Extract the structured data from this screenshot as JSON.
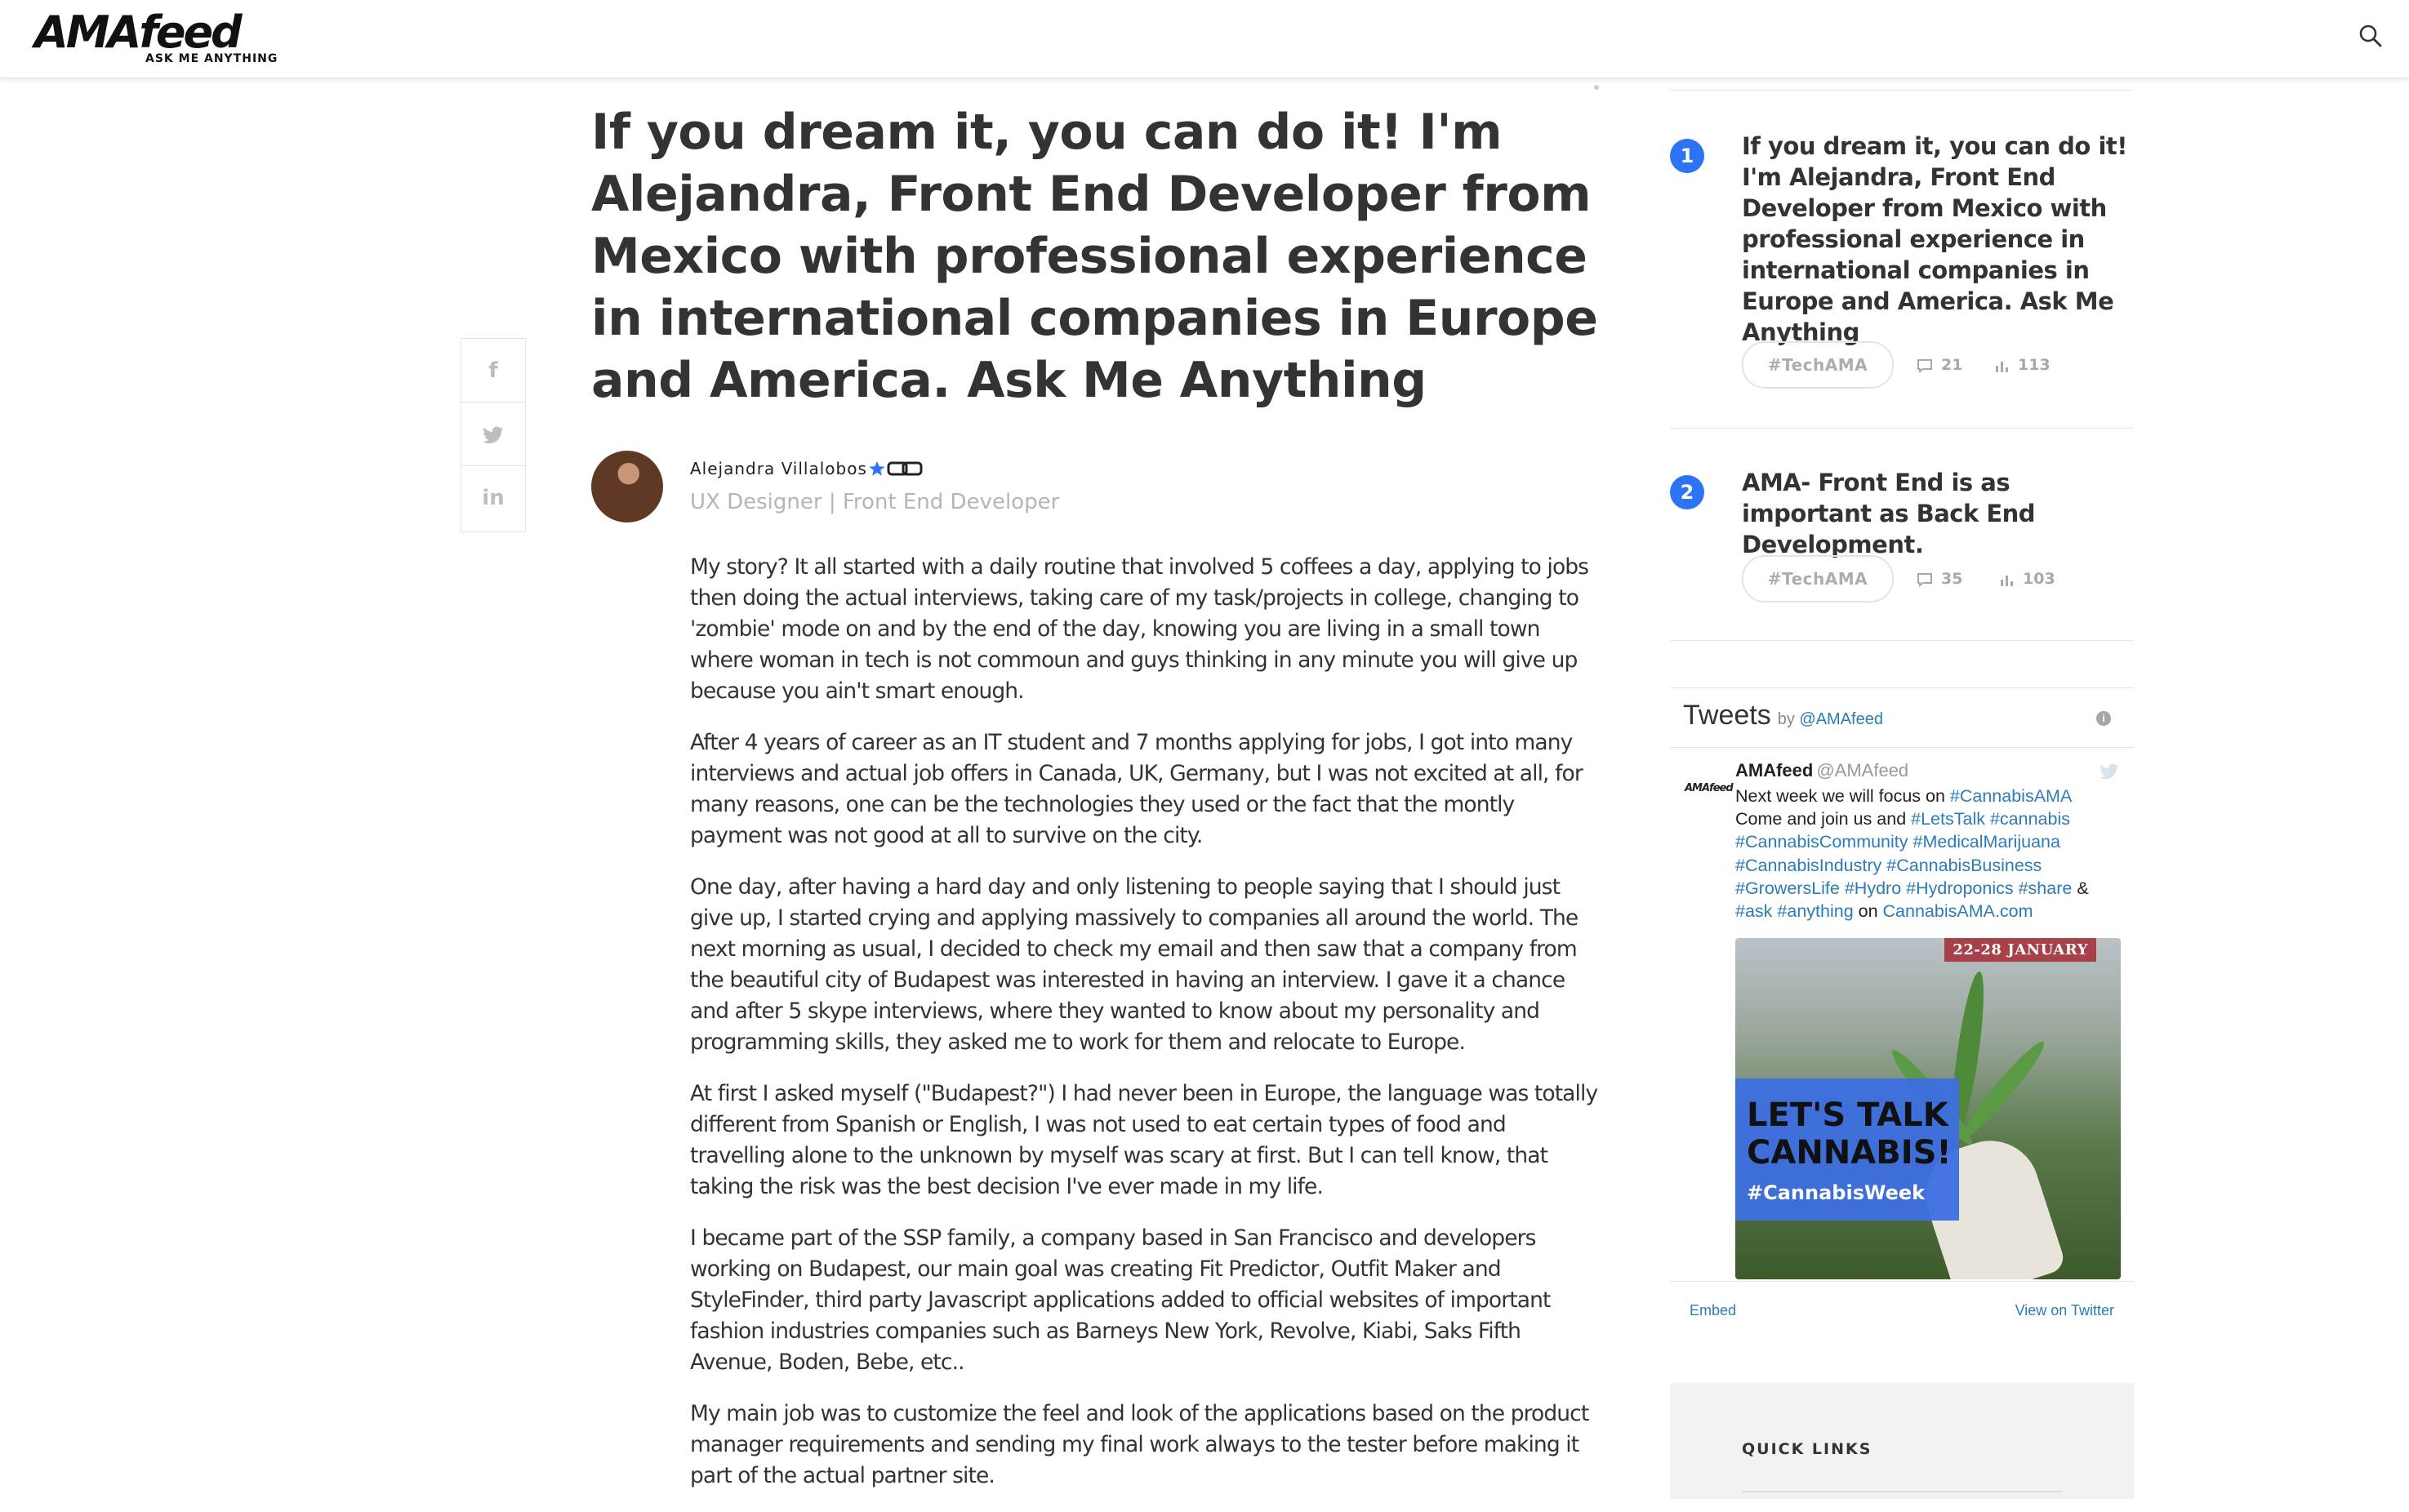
{
  "header": {
    "logo_main": "AMAfeed",
    "logo_sub": "ASK ME ANYTHING"
  },
  "share": {
    "facebook": "f",
    "twitter_icon": "twitter-bird",
    "linkedin": "in"
  },
  "article": {
    "title": "If you dream it, you can do it! I'm Alejandra, Front End Developer from Mexico with professional experience in international companies in Europe and America. Ask Me Anything",
    "author_name": "Alejandra Villalobos",
    "author_role": "UX Designer | Front End Developer",
    "paragraphs": [
      "My story? It all started with a daily routine that involved 5 coffees a day, applying to jobs then doing the actual interviews, taking care of my task/projects in college, changing to 'zombie' mode on and by the end of the day, knowing you are living in a small town where woman in tech is not commoun and guys thinking in any minute you will give up because you ain't smart enough.",
      "After 4 years of career as an IT student and 7 months applying for jobs, I got into many interviews and actual job offers in Canada, UK, Germany, but I was not excited at all, for many reasons, one can be the technologies they used or the fact that the montly payment was not good at all to survive on the city.",
      "One day, after having a hard day and only listening to people saying that I should just give up, I started crying and applying massively to companies all around the world. The next morning as usual, I decided to check my email and then saw that a company from the beautiful city of Budapest was interested in having an interview. I gave it a chance and after 5 skype interviews, where they wanted to know about my personality and programming skills, they asked me to work for them and relocate to Europe.",
      "At first I asked myself (\"Budapest?\") I had never been in Europe, the language was totally different from Spanish or English, I was not used to eat certain types of food and travelling alone to the unknown by myself was scary at first. But I can tell know, that taking the risk was the best decision I've ever made in my life.",
      "I became part of the SSP family, a company based in San Francisco and developers working on Budapest, our main goal was creating Fit Predictor, Outfit Maker and StyleFinder, third party Javascript applications added to official websites of important fashion industries companies such as Barneys New York, Revolve, Kiabi, Saks Fifth Avenue, Boden, Bebe, etc..",
      "My main job was to customize the feel and look of the applications based on the product manager requirements and sending my final work always to the tester before making it part of the actual partner site."
    ]
  },
  "sidebar": {
    "ranked": [
      {
        "rank": "1",
        "title": "If you dream it, you can do it! I'm Alejandra, Front End Developer from Mexico with professional experience in international companies in Europe and America. Ask Me Anything",
        "tag": "#TechAMA",
        "comments": "21",
        "views": "113"
      },
      {
        "rank": "2",
        "title": "AMA- Front End is as important as Back End Development.",
        "tag": "#TechAMA",
        "comments": "35",
        "views": "103"
      }
    ],
    "tweets": {
      "title": "Tweets",
      "by": "by",
      "handle": "@AMAfeed",
      "info": "i",
      "tweet": {
        "avatar_text": "AMAfeed",
        "name": "AMAfeed",
        "handle": "@AMAfeed",
        "text_parts": [
          {
            "t": "Next week we will focus on ",
            "link": false
          },
          {
            "t": "#CannabisAMA",
            "link": true
          },
          {
            "t": " Come and join us and ",
            "link": false
          },
          {
            "t": "#LetsTalk",
            "link": true
          },
          {
            "t": " ",
            "link": false
          },
          {
            "t": "#cannabis",
            "link": true
          },
          {
            "t": " ",
            "link": false
          },
          {
            "t": "#CannabisCommunity",
            "link": true
          },
          {
            "t": " ",
            "link": false
          },
          {
            "t": "#MedicalMarijuana",
            "link": true
          },
          {
            "t": " ",
            "link": false
          },
          {
            "t": "#CannabisIndustry",
            "link": true
          },
          {
            "t": " ",
            "link": false
          },
          {
            "t": "#CannabisBusiness",
            "link": true
          },
          {
            "t": " ",
            "link": false
          },
          {
            "t": "#GrowersLife",
            "link": true
          },
          {
            "t": " ",
            "link": false
          },
          {
            "t": "#Hydro",
            "link": true
          },
          {
            "t": " ",
            "link": false
          },
          {
            "t": "#Hydroponics",
            "link": true
          },
          {
            "t": " ",
            "link": false
          },
          {
            "t": "#share",
            "link": true
          },
          {
            "t": " & ",
            "link": false
          },
          {
            "t": "#ask",
            "link": true
          },
          {
            "t": " ",
            "link": false
          },
          {
            "t": "#anything",
            "link": true
          },
          {
            "t": " on ",
            "link": false
          },
          {
            "t": "CannabisAMA.com",
            "link": true
          }
        ],
        "media_date": "22-28 JANUARY",
        "media_headline": "LET'S TALK CANNABIS!",
        "media_hashtag": "#CannabisWeek"
      },
      "embed": "Embed",
      "view_on_twitter": "View on Twitter"
    },
    "quick_links_title": "QUICK LINKS"
  },
  "colors": {
    "accent_blue": "#2d73f5",
    "twitter_link": "#2b7bb9",
    "text": "#333333",
    "muted": "#b5b5b5"
  }
}
